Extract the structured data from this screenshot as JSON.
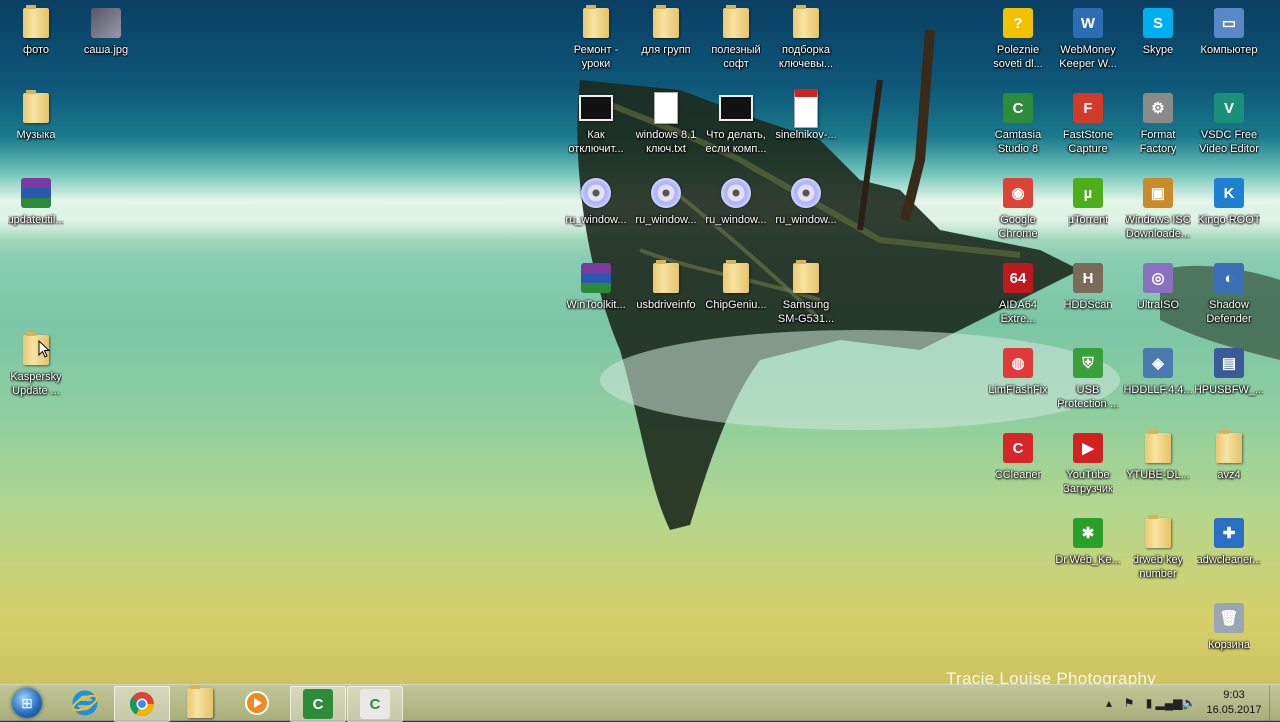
{
  "wallpaper": {
    "credit": "Tracie Louise Photography"
  },
  "desktop_icons": [
    {
      "label": "фото",
      "kind": "folder",
      "icon": "folder-icon"
    },
    {
      "label": "саша.jpg",
      "kind": "image",
      "icon": "image-file-icon"
    },
    {
      "label": "Музыка",
      "kind": "folder",
      "icon": "folder-icon"
    },
    {
      "label": "updateutil...",
      "kind": "archive",
      "icon": "winrar-icon"
    },
    {
      "label": "Kaspersky\nUpdate ...",
      "kind": "folder",
      "icon": "folder-icon"
    },
    {
      "label": "Ремонт -\nуроки",
      "kind": "folder",
      "icon": "folder-icon"
    },
    {
      "label": "для групп",
      "kind": "folder",
      "icon": "folder-icon"
    },
    {
      "label": "полезный\nсофт",
      "kind": "folder",
      "icon": "folder-icon"
    },
    {
      "label": "подборка\nключевы...",
      "kind": "folder",
      "icon": "folder-icon"
    },
    {
      "label": "Как\nотключит...",
      "kind": "video",
      "icon": "video-file-icon"
    },
    {
      "label": "windows 8.1\nключ.txt",
      "kind": "doc",
      "icon": "text-file-icon"
    },
    {
      "label": "Что делать,\nесли комп...",
      "kind": "video",
      "icon": "video-file-icon"
    },
    {
      "label": "sinelnikov-...",
      "kind": "pdf",
      "icon": "pdf-file-icon"
    },
    {
      "label": "ru_window...",
      "kind": "disc",
      "icon": "disc-image-icon"
    },
    {
      "label": "ru_window...",
      "kind": "disc",
      "icon": "disc-image-icon"
    },
    {
      "label": "ru_window...",
      "kind": "disc",
      "icon": "disc-image-icon"
    },
    {
      "label": "ru_window...",
      "kind": "disc",
      "icon": "disc-image-icon"
    },
    {
      "label": "WinToolkit...",
      "kind": "archive",
      "icon": "winrar-icon"
    },
    {
      "label": "usbdriveinfo",
      "kind": "folder",
      "icon": "folder-icon"
    },
    {
      "label": "ChipGeniu...",
      "kind": "folder",
      "icon": "folder-icon"
    },
    {
      "label": "Samsung\nSM-G531...",
      "kind": "folder",
      "icon": "folder-icon"
    },
    {
      "label": "Poleznie\nsoveti dl...",
      "kind": "app",
      "icon": "help-icon",
      "color": "#f2c200",
      "glyph": "?"
    },
    {
      "label": "WebMoney\nKeeper W...",
      "kind": "app",
      "icon": "webmoney-icon",
      "color": "#2d6db5",
      "glyph": "W"
    },
    {
      "label": "Skype",
      "kind": "app",
      "icon": "skype-icon",
      "color": "#00aff0",
      "glyph": "S"
    },
    {
      "label": "Компьютер",
      "kind": "app",
      "icon": "computer-icon",
      "color": "#5a88c6",
      "glyph": "▭"
    },
    {
      "label": "Camtasia\nStudio 8",
      "kind": "app",
      "icon": "camtasia-icon",
      "color": "#2e8b3a",
      "glyph": "C"
    },
    {
      "label": "FastStone\nCapture",
      "kind": "app",
      "icon": "faststone-icon",
      "color": "#d23a2a",
      "glyph": "F"
    },
    {
      "label": "Format\nFactory",
      "kind": "app",
      "icon": "format-factory-icon",
      "color": "#8a8a8a",
      "glyph": "⚙"
    },
    {
      "label": "VSDC Free\nVideo Editor",
      "kind": "app",
      "icon": "vsdc-icon",
      "color": "#1b8f7a",
      "glyph": "V"
    },
    {
      "label": "Google\nChrome",
      "kind": "app",
      "icon": "chrome-icon",
      "color": "#db4437",
      "glyph": "◉"
    },
    {
      "label": "µTorrent",
      "kind": "app",
      "icon": "utorrent-icon",
      "color": "#4caf1a",
      "glyph": "µ"
    },
    {
      "label": "Windows ISO\nDownloade...",
      "kind": "app",
      "icon": "iso-downloader-icon",
      "color": "#c98a2a",
      "glyph": "▣"
    },
    {
      "label": "Kingo ROOT",
      "kind": "app",
      "icon": "kingo-root-icon",
      "color": "#1f7fd0",
      "glyph": "K"
    },
    {
      "label": "AIDA64\nExtre...",
      "kind": "app",
      "icon": "aida64-icon",
      "color": "#c0181f",
      "glyph": "64"
    },
    {
      "label": "HDDScan",
      "kind": "app",
      "icon": "hddscan-icon",
      "color": "#7a6a5a",
      "glyph": "H"
    },
    {
      "label": "UltraISO",
      "kind": "app",
      "icon": "ultraiso-icon",
      "color": "#8a70c0",
      "glyph": "◎"
    },
    {
      "label": "Shadow\nDefender",
      "kind": "app",
      "icon": "shadow-defender-icon",
      "color": "#3a6fb8",
      "glyph": "◐"
    },
    {
      "label": "LimFlashFix",
      "kind": "app",
      "icon": "lifebuoy-icon",
      "color": "#e23a3a",
      "glyph": "◍"
    },
    {
      "label": "USB\nProtection ...",
      "kind": "app",
      "icon": "usb-protection-icon",
      "color": "#3aa03a",
      "glyph": "⛨"
    },
    {
      "label": "HDDLLF.4.4...",
      "kind": "app",
      "icon": "hddllf-icon",
      "color": "#4a7ab0",
      "glyph": "◈"
    },
    {
      "label": "HPUSBFW_...",
      "kind": "app",
      "icon": "hpusbfw-icon",
      "color": "#3a5a9a",
      "glyph": "▤"
    },
    {
      "label": "CCleaner",
      "kind": "app",
      "icon": "ccleaner-icon",
      "color": "#d7262a",
      "glyph": "C"
    },
    {
      "label": "YouTube\nЗагрузчик",
      "kind": "app",
      "icon": "youtube-downloader-icon",
      "color": "#d32020",
      "glyph": "▶"
    },
    {
      "label": "YTUBE-DL...",
      "kind": "folder",
      "icon": "folder-icon"
    },
    {
      "label": "avz4",
      "kind": "folder",
      "icon": "folder-icon"
    },
    {
      "label": "Dr.Web_Ke...",
      "kind": "app",
      "icon": "drweb-spider-icon",
      "color": "#2aa02a",
      "glyph": "✱"
    },
    {
      "label": "drweb key\nnumber",
      "kind": "folder",
      "icon": "folder-icon"
    },
    {
      "label": "adwcleaner...",
      "kind": "app",
      "icon": "adwcleaner-icon",
      "color": "#2b6fc4",
      "glyph": "✚"
    },
    {
      "label": "Корзина",
      "kind": "app",
      "icon": "recycle-bin-icon",
      "color": "#9aa7b3",
      "glyph": "🗑"
    }
  ],
  "taskbar": {
    "clock": {
      "time": "9:03",
      "date": "16.05.2017"
    },
    "tray_icons": [
      "chevron-up-icon",
      "flag-icon",
      "usb-icon",
      "network-icon",
      "volume-icon"
    ]
  }
}
